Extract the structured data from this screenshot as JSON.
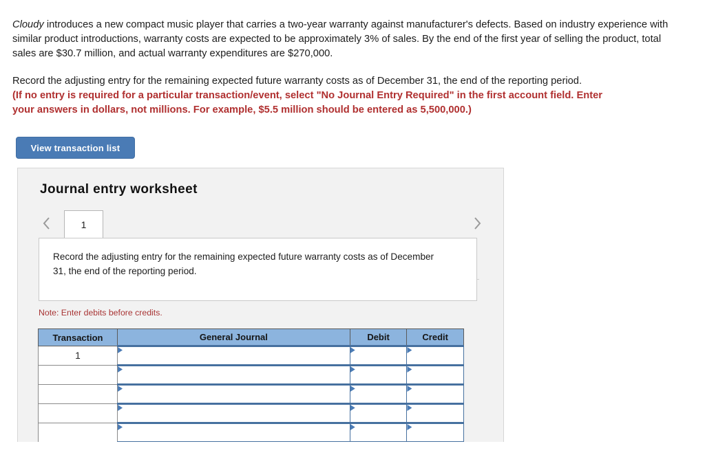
{
  "problem": {
    "company": "Cloudy",
    "paragraph_rest": " introduces a new compact music player that carries a two-year warranty against manufacturer's defects. Based on industry experience with similar product introductions, warranty costs are expected to be approximately 3% of sales. By the end of the first year of selling the product, total sales are $30.7 million, and actual warranty expenditures are $270,000."
  },
  "requirement": {
    "line1": "Record the adjusting entry for the remaining expected future warranty costs as of December 31, the end of the reporting period.",
    "red_line1": "(If no entry is required for a particular transaction/event, select \"No Journal Entry Required\" in the first account field. Enter",
    "red_line2": "your answers in dollars, not millions. For example, $5.5 million should be entered as 5,500,000.)"
  },
  "toolbar": {
    "view_transaction_list_label": "View transaction list"
  },
  "worksheet": {
    "title": "Journal entry worksheet",
    "prev_icon": "chevron-left-icon",
    "next_icon": "chevron-right-icon",
    "tabs": [
      {
        "label": "1",
        "active": true
      }
    ],
    "instruction": "Record the adjusting entry for the remaining expected future warranty costs as of December 31, the end of the reporting period.",
    "note": "Note: Enter debits before credits."
  },
  "journal_table": {
    "headers": [
      "Transaction",
      "General Journal",
      "Debit",
      "Credit"
    ],
    "rows": [
      {
        "transaction": "1",
        "general_journal": "",
        "debit": "",
        "credit": ""
      },
      {
        "transaction": "",
        "general_journal": "",
        "debit": "",
        "credit": ""
      },
      {
        "transaction": "",
        "general_journal": "",
        "debit": "",
        "credit": ""
      },
      {
        "transaction": "",
        "general_journal": "",
        "debit": "",
        "credit": ""
      },
      {
        "transaction": "",
        "general_journal": "",
        "debit": "",
        "credit": ""
      },
      {
        "transaction": "",
        "general_journal": "",
        "debit": "",
        "credit": ""
      }
    ]
  },
  "colors": {
    "button_blue": "#4a7bb5",
    "header_blue": "#8cb4de",
    "note_red": "#a83434",
    "instruction_red": "#b03030",
    "panel_gray": "#f2f2f2"
  }
}
